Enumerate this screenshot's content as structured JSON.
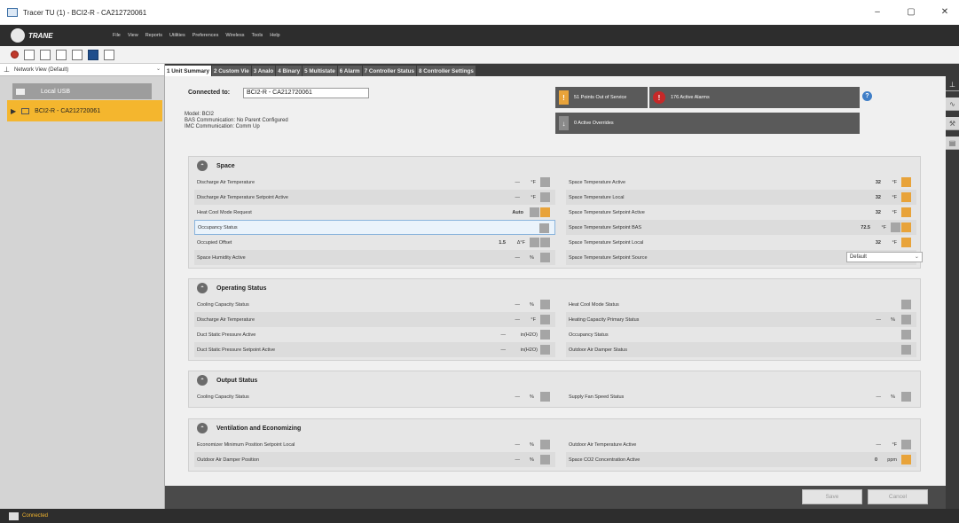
{
  "window": {
    "title": "Tracer TU (1) - BCI2-R - CA212720061",
    "controls": [
      "minimize-icon",
      "maximize-icon",
      "close-icon"
    ]
  },
  "menubar": {
    "brand": "TRANE",
    "items": [
      "File",
      "View",
      "Reports",
      "Utilities",
      "Preferences",
      "Wireless",
      "Tools",
      "Help"
    ]
  },
  "toolbar": {
    "icons": [
      "stop-icon",
      "panel-icon",
      "device-icon",
      "list-icon",
      "network-icon",
      "folder-icon",
      "chart-icon"
    ]
  },
  "leftpanel": {
    "network_view": "Network View (Default)",
    "local_usb": "Local USB",
    "device": "BCI2-R - CA212720061"
  },
  "tabs": [
    "1 Unit Summary",
    "2 Custom Vie",
    "3 Analo",
    "4 Binary",
    "5 Multistate",
    "6 Alarm",
    "7 Controller Status",
    "8 Controller Settings"
  ],
  "connection": {
    "label": "Connected to:",
    "value": "BCI2-R - CA212720061"
  },
  "info": {
    "model": "Model:  BCI2",
    "bas": "BAS Communication:  No Parent Configured",
    "imc": "IMC Communication:  Comm Up"
  },
  "status_buttons": {
    "out_of_service": "51 Points Out of Service",
    "alarms": "176 Active Alarms",
    "overrides": "0 Active Overrides"
  },
  "colors": {
    "accent_orange": "#e8a33a",
    "selection_yellow": "#f4b62e",
    "alarm_red": "#c62828"
  },
  "sections": {
    "space": {
      "title": "Space",
      "left": [
        {
          "label": "Discharge Air Temperature",
          "value": "—",
          "unit": "°F"
        },
        {
          "label": "Discharge Air Temperature Setpoint Active",
          "value": "—",
          "unit": "°F"
        },
        {
          "label": "Heat Cool Mode Request",
          "value": "Auto",
          "unit": ""
        },
        {
          "label": "Occupancy Status",
          "value": "",
          "unit": ""
        },
        {
          "label": "Occupied Offset",
          "value": "1.5",
          "unit": "Δ°F"
        },
        {
          "label": "Space Humidity Active",
          "value": "—",
          "unit": "%"
        }
      ],
      "right": [
        {
          "label": "Space Temperature Active",
          "value": "32",
          "unit": "°F"
        },
        {
          "label": "Space Temperature Local",
          "value": "32",
          "unit": "°F"
        },
        {
          "label": "Space Temperature Setpoint Active",
          "value": "32",
          "unit": "°F"
        },
        {
          "label": "Space Temperature Setpoint BAS",
          "value": "72.5",
          "unit": "°F"
        },
        {
          "label": "Space Temperature Setpoint Local",
          "value": "32",
          "unit": "°F"
        },
        {
          "label": "Space Temperature Setpoint Source",
          "value": "Default",
          "unit": ""
        }
      ]
    },
    "operating": {
      "title": "Operating Status",
      "left": [
        {
          "label": "Cooling Capacity Status",
          "value": "—",
          "unit": "%"
        },
        {
          "label": "Discharge Air Temperature",
          "value": "—",
          "unit": "°F"
        },
        {
          "label": "Duct Static Pressure Active",
          "value": "—",
          "unit": "in(H2O)"
        },
        {
          "label": "Duct Static Pressure Setpoint Active",
          "value": "—",
          "unit": "in(H2O)"
        }
      ],
      "right": [
        {
          "label": "Heat Cool Mode Status",
          "value": "",
          "unit": ""
        },
        {
          "label": "Heating Capacity Primary Status",
          "value": "—",
          "unit": "%"
        },
        {
          "label": "Occupancy Status",
          "value": "",
          "unit": ""
        },
        {
          "label": "Outdoor Air Damper Status",
          "value": "",
          "unit": ""
        }
      ]
    },
    "output": {
      "title": "Output Status",
      "left": [
        {
          "label": "Cooling Capacity Status",
          "value": "—",
          "unit": "%"
        }
      ],
      "right": [
        {
          "label": "Supply Fan Speed Status",
          "value": "—",
          "unit": "%"
        }
      ]
    },
    "ventilation": {
      "title": "Ventilation and Economizing",
      "left": [
        {
          "label": "Economizer Minimum Position Setpoint Local",
          "value": "—",
          "unit": "%"
        },
        {
          "label": "Outdoor Air Damper Position",
          "value": "—",
          "unit": "%"
        }
      ],
      "right": [
        {
          "label": "Outdoor Air Temperature Active",
          "value": "—",
          "unit": "°F"
        },
        {
          "label": "Space CO2 Concentration Active",
          "value": "0",
          "unit": "ppm"
        }
      ]
    }
  },
  "buttons": {
    "save": "Save",
    "cancel": "Cancel"
  },
  "statusbar": {
    "connection": "Connected"
  }
}
